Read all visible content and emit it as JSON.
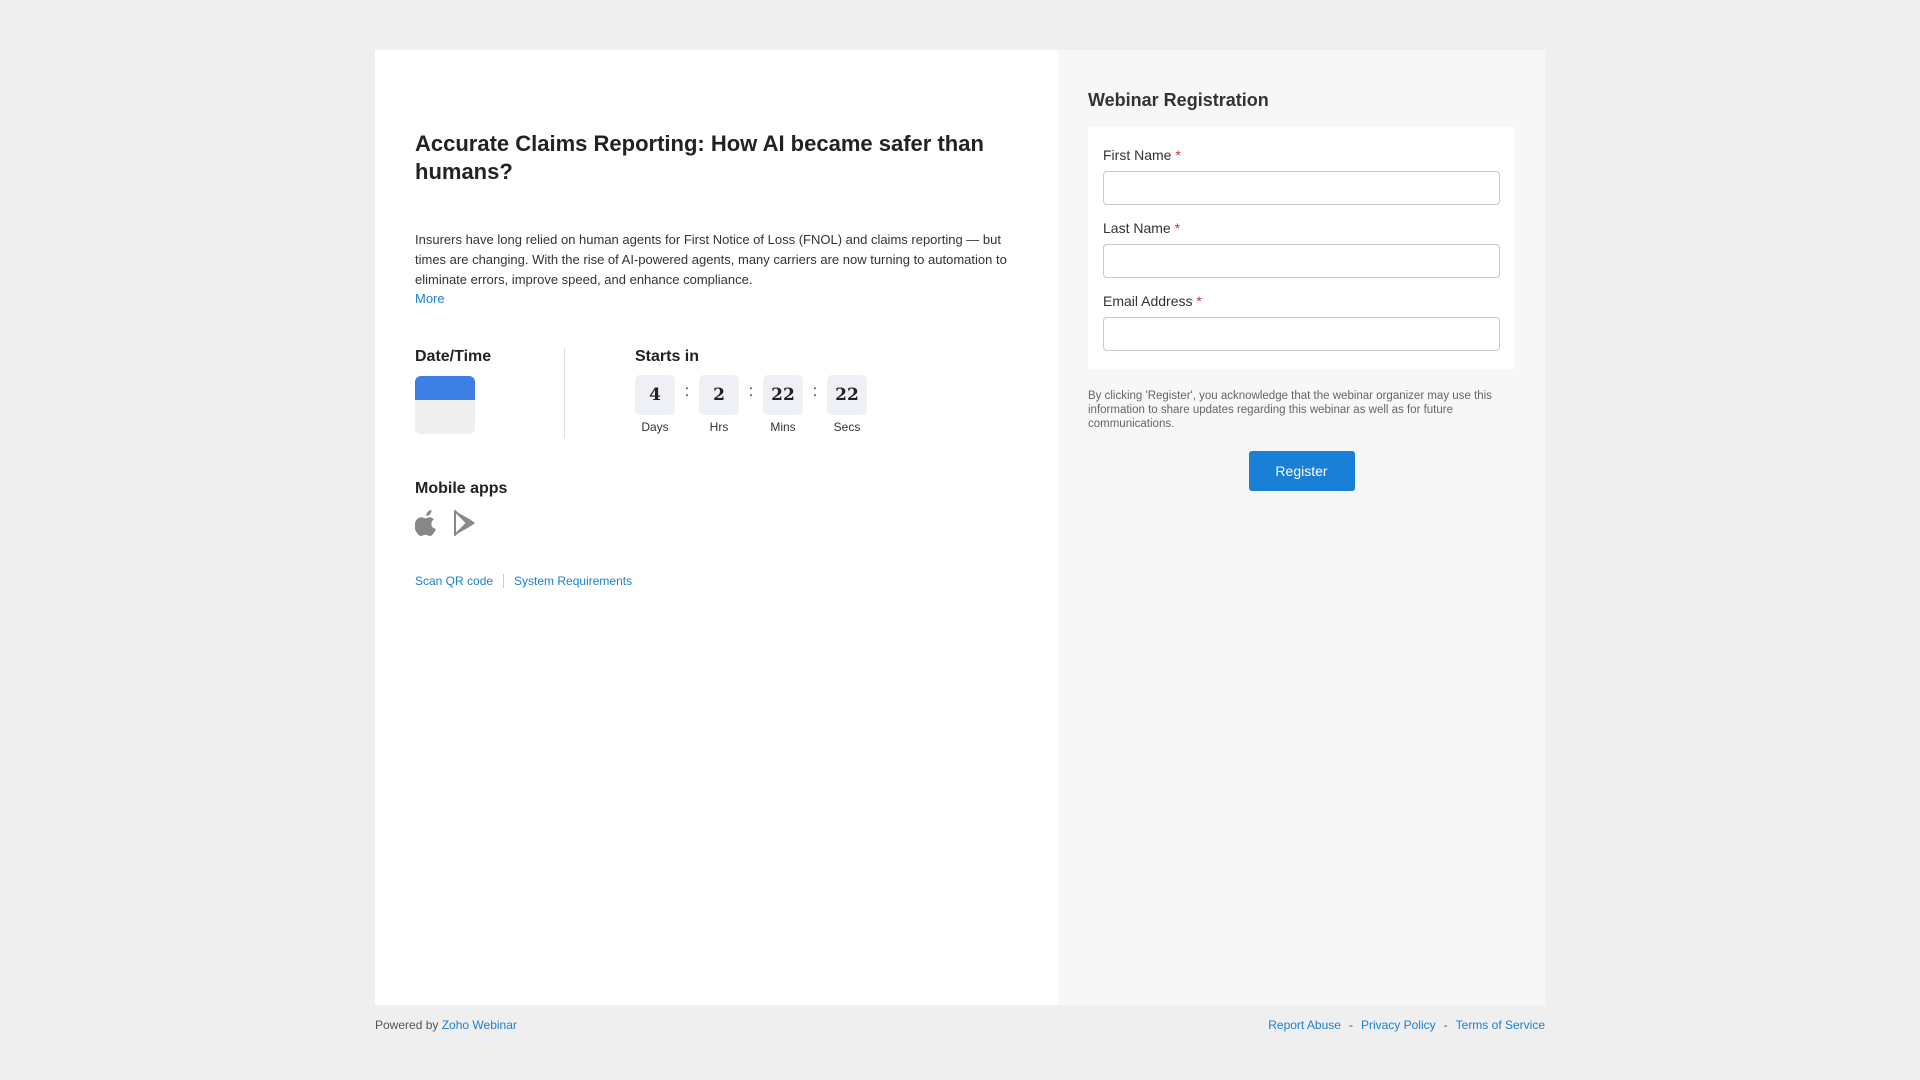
{
  "event": {
    "title": "Accurate Claims Reporting: How AI became safer than humans?",
    "description": "Insurers have long relied on human agents for First Notice of Loss (FNOL) and claims reporting — but times are changing. With the rise of AI-powered agents, many carriers are now turning to automation to eliminate errors, improve speed, and enhance compliance.",
    "more_label": "More"
  },
  "datetime": {
    "heading": "Date/Time",
    "calendar_icon": "calendar-icon"
  },
  "countdown": {
    "heading": "Starts in",
    "days": "4",
    "days_label": "Days",
    "hours": "2",
    "hours_label": "Hrs",
    "mins": "22",
    "mins_label": "Mins",
    "secs": "22",
    "secs_label": "Secs",
    "separator": ":"
  },
  "mobile_apps": {
    "heading": "Mobile apps",
    "icons": [
      "apple-icon",
      "google-play-icon"
    ]
  },
  "links": {
    "scan_qr": "Scan QR code",
    "system_requirements": "System Requirements"
  },
  "registration": {
    "title": "Webinar Registration",
    "first_name_label": "First Name",
    "last_name_label": "Last Name",
    "email_label": "Email Address",
    "required_mark": "*",
    "first_name_value": "",
    "last_name_value": "",
    "email_value": "",
    "consent": "By clicking 'Register', you acknowledge that the webinar organizer may use this information to share updates regarding this webinar as well as for future communications.",
    "register_label": "Register"
  },
  "footer": {
    "powered_by": "Powered by",
    "brand": "Zoho Webinar",
    "report_abuse": "Report Abuse",
    "privacy_policy": "Privacy Policy",
    "terms": "Terms of Service",
    "sep": "-"
  },
  "colors": {
    "accent": "#1a7fd6",
    "calendar": "#3d7fe4",
    "required": "#d32f2f"
  }
}
